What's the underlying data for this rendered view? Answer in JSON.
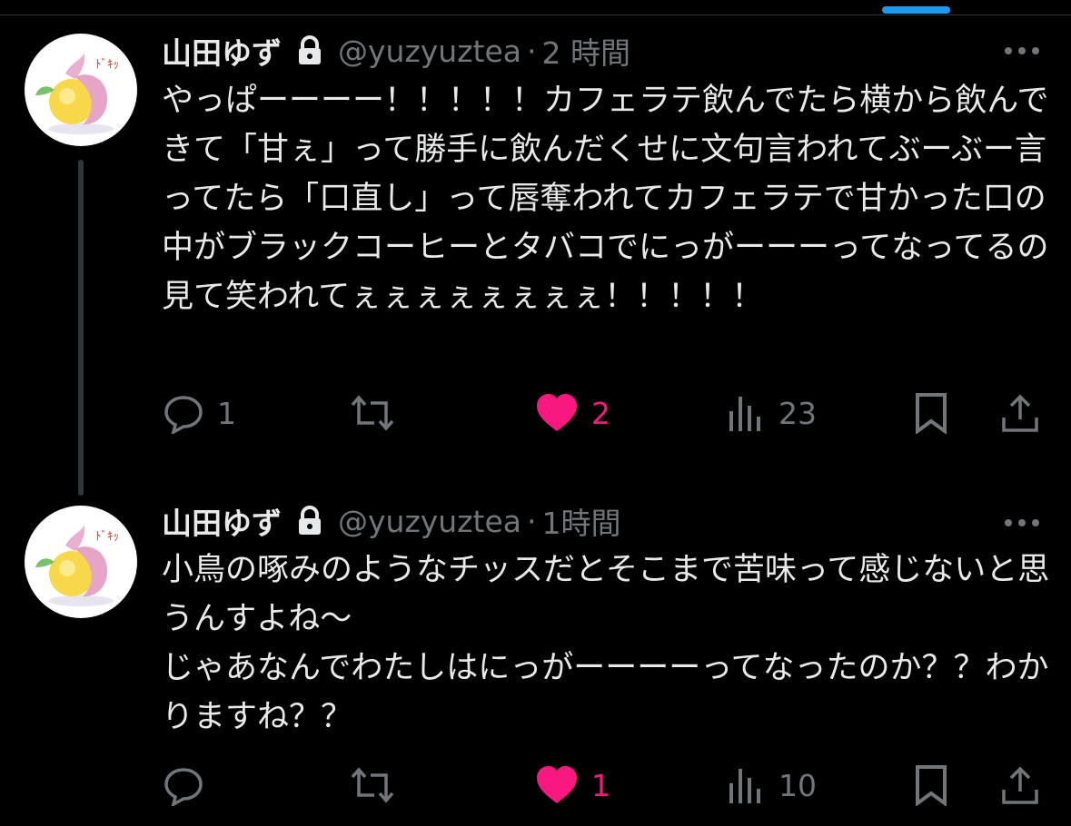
{
  "colors": {
    "background": "#000000",
    "text_primary": "#e7e9ea",
    "text_secondary": "#71767b",
    "like_pink": "#f91880",
    "thread_line": "#333639",
    "scroll_indicator": "#1d9bf0"
  },
  "icons": {
    "lock": "lock-icon",
    "more": "more-icon",
    "reply": "reply-icon",
    "retweet": "retweet-icon",
    "like": "heart-icon",
    "views": "views-icon",
    "bookmark": "bookmark-icon",
    "share": "share-icon",
    "avatar": "lemon-avatar"
  },
  "tweets": [
    {
      "author_name": "山田ゆず",
      "handle": "@yuzyuztea",
      "separator": "·",
      "time": "2 時間",
      "text": "やっぱーーーー！！！！！カフェラテ飲んでたら横から飲んできて「甘ぇ」って勝手に飲んだくせに文句言われてぶーぶー言ってたら「口直し」って唇奪われてカフェラテで甘かった口の中がブラックコーヒーとタバコでにっがーーーってなってるの見て笑われてぇぇぇぇぇぇぇぇ！！！！！",
      "avatar_text": "ﾄﾞｷｯ",
      "replies": "1",
      "retweets": "",
      "likes": "2",
      "liked": true,
      "views": "23"
    },
    {
      "author_name": "山田ゆず",
      "handle": "@yuzyuztea",
      "separator": "·",
      "time": "1時間",
      "text": "小鳥の啄みのようなチッスだとそこまで苦味って感じないと思うんすよね〜\nじゃあなんでわたしはにっがーーーーってなったのか？？わかりますね？？",
      "avatar_text": "ﾄﾞｷｯ",
      "replies": "",
      "retweets": "",
      "likes": "1",
      "liked": true,
      "views": "10"
    }
  ]
}
